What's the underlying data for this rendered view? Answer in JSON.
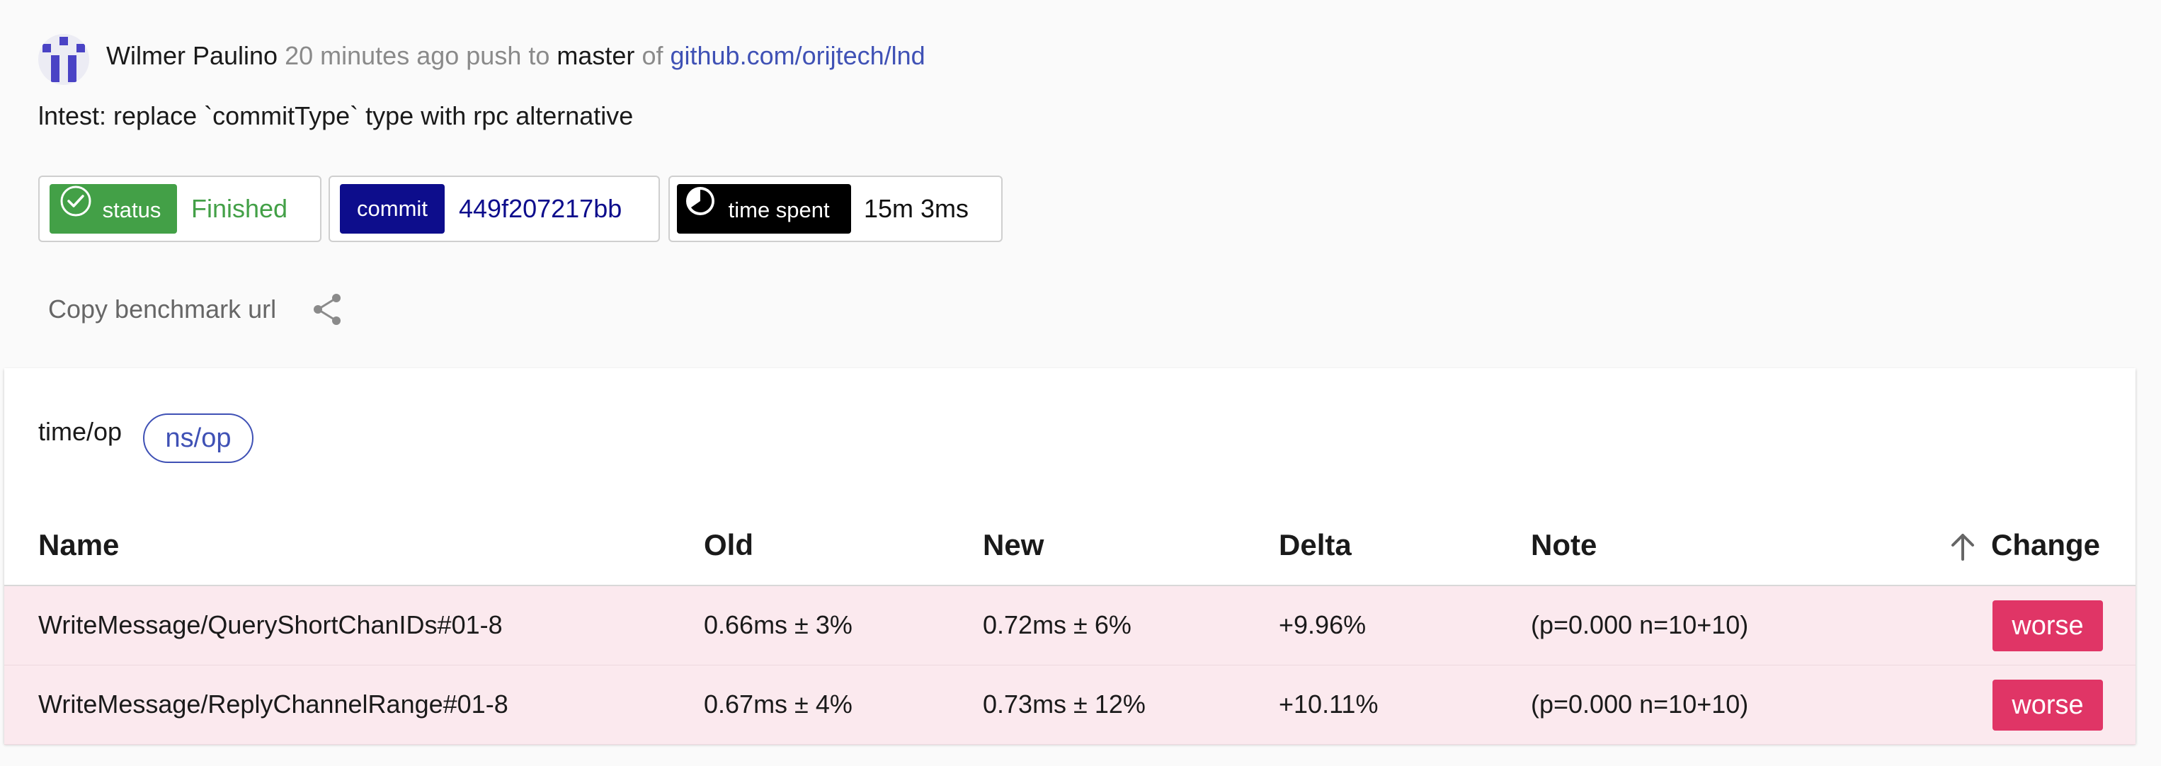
{
  "header": {
    "author": "Wilmer Paulino",
    "time_ago": "20 minutes ago",
    "push_word": "push to",
    "branch": "master",
    "of_word": "of",
    "repo": "github.com/orijtech/lnd",
    "commit_message": "lntest: replace `commitType` type with rpc alternative"
  },
  "chips": {
    "status": {
      "label": "status",
      "value": "Finished",
      "icon": "check-circle-icon",
      "color": "#43a047"
    },
    "commit": {
      "label": "commit",
      "value": "449f207217bb",
      "color": "#0d0d8c"
    },
    "time": {
      "label": "time spent",
      "value": "15m 3ms",
      "icon": "clock-icon",
      "color": "#000000"
    }
  },
  "copy_url": {
    "label": "Copy benchmark url",
    "icon": "share-icon"
  },
  "units": {
    "metric": "time/op",
    "selected_unit": "ns/op"
  },
  "table": {
    "columns": [
      "Name",
      "Old",
      "New",
      "Delta",
      "Note",
      "Change"
    ],
    "sort_icon": "arrow-up-icon",
    "rows": [
      {
        "name": "WriteMessage/QueryShortChanIDs#01-8",
        "old": "0.66ms ± 3%",
        "new": "0.72ms ± 6%",
        "delta": "+9.96%",
        "note": "(p=0.000 n=10+10)",
        "change": "worse"
      },
      {
        "name": "WriteMessage/ReplyChannelRange#01-8",
        "old": "0.67ms ± 4%",
        "new": "0.73ms ± 12%",
        "delta": "+10.11%",
        "note": "(p=0.000 n=10+10)",
        "change": "worse"
      }
    ]
  },
  "colors": {
    "link": "#3f51b5",
    "worse_badge": "#e03566",
    "worse_row": "#fbe9ee"
  }
}
